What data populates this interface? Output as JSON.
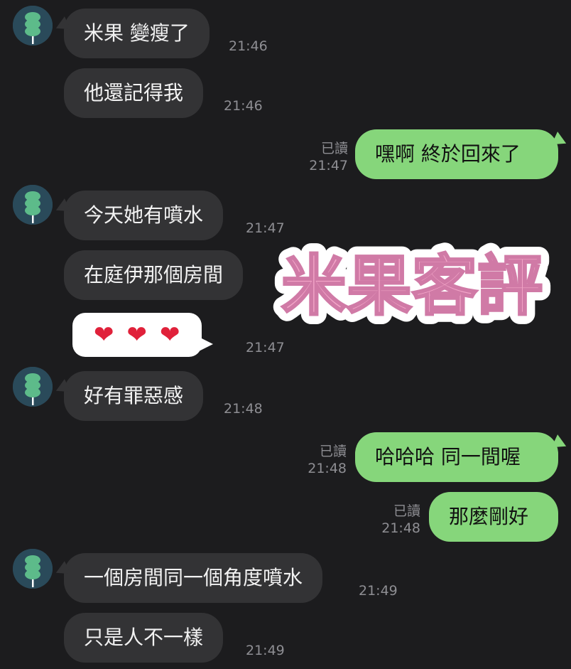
{
  "colors": {
    "background": "#1c1c1e",
    "incoming_bubble": "#333335",
    "outgoing_bubble": "#86d67b",
    "timestamp": "#8e8e93",
    "sticker_fill": "#f3a6c8",
    "sticker_outline": "#ffffff"
  },
  "sticker": {
    "text": "米果客評"
  },
  "messages": [
    {
      "text": "米果 變瘦了",
      "time": "21:46"
    },
    {
      "text": "他還記得我",
      "time": "21:46"
    },
    {
      "text": "嘿啊 終於回來了",
      "read": "已讀",
      "time": "21:47"
    },
    {
      "text": "今天她有噴水",
      "time": "21:47"
    },
    {
      "text": "在庭伊那個房間",
      "time": ""
    },
    {
      "hearts": [
        "❤",
        "❤",
        "❤"
      ],
      "time": "21:47"
    },
    {
      "text": "好有罪惡感",
      "time": "21:48"
    },
    {
      "text": "哈哈哈 同一間喔",
      "read": "已讀",
      "time": "21:48"
    },
    {
      "text": "那麼剛好",
      "read": "已讀",
      "time": "21:48"
    },
    {
      "text": "一個房間同一個角度噴水",
      "time": "21:49"
    },
    {
      "text": "只是人不一樣",
      "time": "21:49"
    }
  ]
}
